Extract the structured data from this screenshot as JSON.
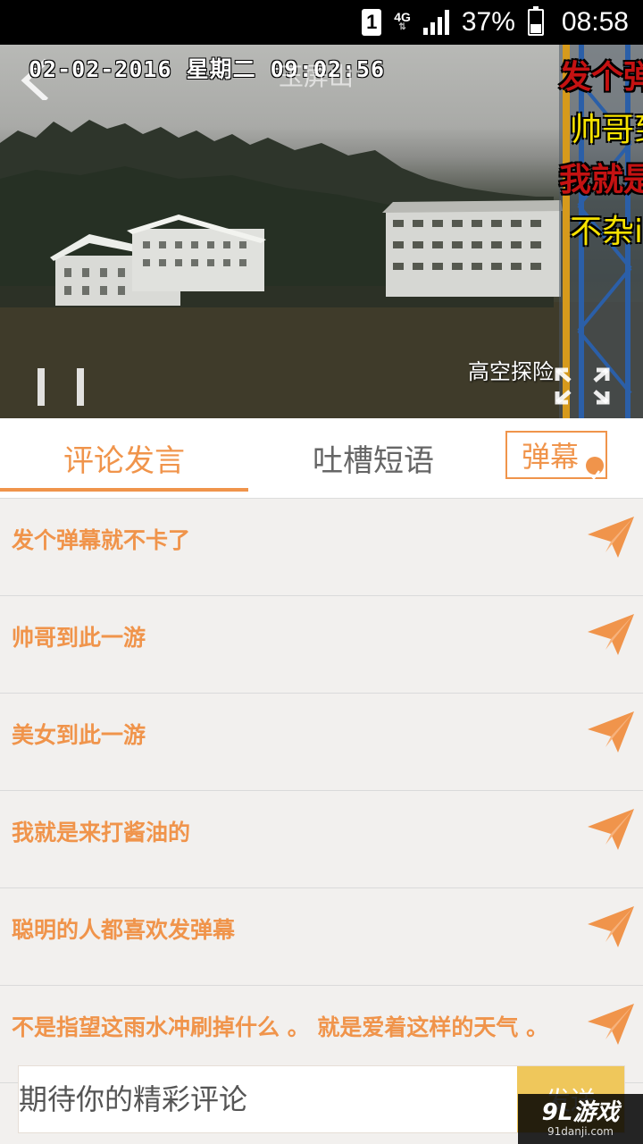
{
  "status_bar": {
    "sim": "1",
    "network": "4G",
    "battery": "37%",
    "battery_level": 0.37,
    "time": "08:58"
  },
  "video": {
    "timestamp": "02-02-2016 星期二 09:02:56",
    "title": "玉屏山",
    "watermark": "高空探险",
    "danmaku": [
      "发个弹",
      "帅哥到",
      "我就是",
      "不杂i"
    ]
  },
  "tabs": {
    "comment": "评论发言",
    "phrases": "吐槽短语",
    "danmaku": "弹幕"
  },
  "phrases": [
    "发个弹幕就不卡了",
    "帅哥到此一游",
    "美女到此一游",
    "我就是来打酱油的",
    "聪明的人都喜欢发弹幕",
    "不是指望这雨水冲刷掉什么 。 就是爱着这样的天气 。"
  ],
  "input": {
    "placeholder": "期待你的精彩评论",
    "send_label": "发送"
  },
  "site_watermark": {
    "logo": "9L游戏",
    "url": "91danji.com"
  },
  "colors": {
    "accent": "#f0944b",
    "send_button": "#efc75b",
    "danmaku_red": "#c41212",
    "danmaku_yellow": "#f6e200"
  }
}
